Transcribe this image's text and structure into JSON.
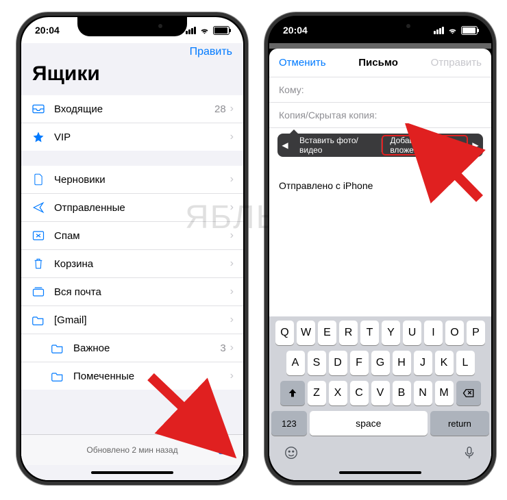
{
  "status": {
    "time": "20:04"
  },
  "left": {
    "edit": "Править",
    "title": "Ящики",
    "group1": [
      {
        "icon": "inbox",
        "label": "Входящие",
        "count": "28"
      },
      {
        "icon": "star",
        "label": "VIP",
        "count": ""
      }
    ],
    "group2": [
      {
        "icon": "doc",
        "label": "Черновики",
        "count": "",
        "indent": false
      },
      {
        "icon": "send",
        "label": "Отправленные",
        "count": "",
        "indent": false
      },
      {
        "icon": "spam",
        "label": "Спам",
        "count": "",
        "indent": false
      },
      {
        "icon": "trash",
        "label": "Корзина",
        "count": "",
        "indent": false
      },
      {
        "icon": "all",
        "label": "Вся почта",
        "count": "",
        "indent": false
      },
      {
        "icon": "folder",
        "label": "[Gmail]",
        "count": "",
        "indent": false
      },
      {
        "icon": "folder",
        "label": "Важное",
        "count": "3",
        "indent": true
      },
      {
        "icon": "folder",
        "label": "Помеченные",
        "count": "",
        "indent": true
      }
    ],
    "updated": "Обновлено 2 мин назад"
  },
  "right": {
    "cancel": "Отменить",
    "title": "Письмо",
    "send": "Отправить",
    "to_label": "Кому:",
    "cc_label": "Копия/Скрытая копия:",
    "callout_opt1": "Вставить фото/видео",
    "callout_opt2": "Добавить вложение",
    "signature": "Отправлено с iPhone",
    "keys_r1": [
      "Q",
      "W",
      "E",
      "R",
      "T",
      "Y",
      "U",
      "I",
      "O",
      "P"
    ],
    "keys_r2": [
      "A",
      "S",
      "D",
      "F",
      "G",
      "H",
      "J",
      "K",
      "L"
    ],
    "keys_r3": [
      "Z",
      "X",
      "C",
      "V",
      "B",
      "N",
      "M"
    ],
    "k123": "123",
    "kspace": "space",
    "kreturn": "return"
  },
  "watermark": "ЯБЛЫК"
}
